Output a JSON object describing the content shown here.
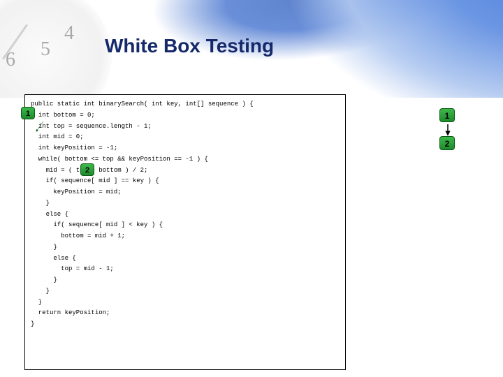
{
  "title": "White Box Testing",
  "clock_numbers": {
    "n4": "4",
    "n5": "5",
    "n6": "6"
  },
  "code": {
    "l0": "public static int binarySearch( int key, int[] sequence ) {",
    "l1": "  int bottom = 0;",
    "l2": "  int top = sequence.length - 1;",
    "l3": "  int mid = 0;",
    "l4": "  int keyPosition = -1;",
    "l5": "",
    "l6": "  while( bottom <= top && keyPosition == -1 ) {",
    "l7": "    mid = ( top + bottom ) / 2;",
    "l8": "    if( sequence[ mid ] == key ) {",
    "l9": "      keyPosition = mid;",
    "l10": "    }",
    "l11": "    else {",
    "l12": "      if( sequence[ mid ] < key ) {",
    "l13": "        bottom = mid + 1;",
    "l14": "      }",
    "l15": "      else {",
    "l16": "        top = mid - 1;",
    "l17": "      }",
    "l18": "    }",
    "l19": "  }",
    "l20": "  return keyPosition;",
    "l21": "}"
  },
  "badges": {
    "code_node_1": "1",
    "code_node_2": "2",
    "flow_node_1": "1",
    "flow_node_2": "2"
  }
}
